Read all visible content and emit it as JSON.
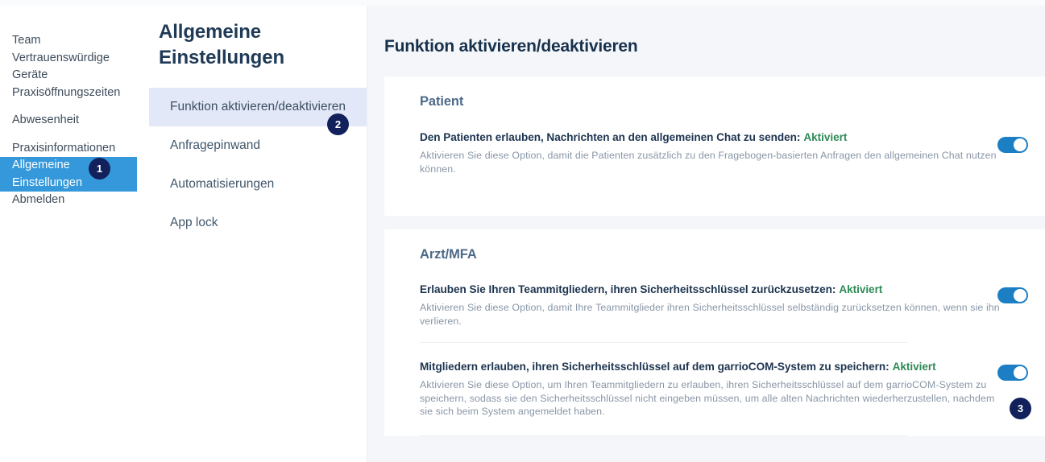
{
  "primary_nav": {
    "items": [
      {
        "label": "Team",
        "active": false,
        "gap": false
      },
      {
        "label": "Vertrauenswürdige\nGeräte",
        "active": false,
        "gap": false
      },
      {
        "label": "Praxisöffnungszeiten",
        "active": false,
        "gap": false
      },
      {
        "label": "Abwesenheit",
        "active": false,
        "gap": true
      },
      {
        "label": "Praxisinformationen",
        "active": false,
        "gap": true
      },
      {
        "label": "Allgemeine\nEinstellungen",
        "active": true,
        "gap": false
      },
      {
        "label": "Abmelden",
        "active": false,
        "gap": false
      }
    ],
    "active_bg_color": "#3498db"
  },
  "secondary_nav": {
    "title": "Allgemeine\nEinstellungen",
    "items": [
      {
        "label": "Funktion aktivieren/deaktivieren",
        "active": true
      },
      {
        "label": "Anfragepinwand",
        "active": false
      },
      {
        "label": "Automatisierungen",
        "active": false
      },
      {
        "label": "App lock",
        "active": false
      }
    ],
    "active_bg_color": "#e3e8f8"
  },
  "main": {
    "page_title": "Funktion aktivieren/deaktivieren",
    "cards": [
      {
        "heading": "Patient",
        "rows": [
          {
            "title": "Den Patienten erlauben, Nachrichten an den allgemeinen Chat zu senden:",
            "status": "Aktiviert",
            "description": "Aktivieren Sie diese Option, damit die Patienten zusätzlich zu den Fragebogen-basierten Anfragen den allgemeinen Chat nutzen können.",
            "toggle_on": true
          }
        ]
      },
      {
        "heading": "Arzt/MFA",
        "rows": [
          {
            "title": "Erlauben Sie Ihren Teammitgliedern, ihren Sicherheitsschlüssel zurückzusetzen:",
            "status": "Aktiviert",
            "description": "Aktivieren Sie diese Option, damit Ihre Teammitglieder ihren Sicherheitsschlüssel selbständig zurücksetzen können, wenn sie ihn verlieren.",
            "toggle_on": true
          },
          {
            "title": "Mitgliedern erlauben, ihren Sicherheitsschlüssel auf dem garrioCOM-System zu speichern:",
            "status": "Aktiviert",
            "description": "Aktivieren Sie diese Option, um Ihren Teammitgliedern zu erlauben, ihren Sicherheitsschlüssel auf dem garrioCOM-System zu speichern, sodass sie den Sicherheitsschlüssel nicht eingeben müssen, um alle alten Nachrichten wiederherzustellen, nachdem sie sich beim System angemeldet haben.",
            "toggle_on": true
          }
        ]
      }
    ],
    "status_color": "#2e8b57",
    "toggle_on_color": "#1c7fc4"
  },
  "annotations": {
    "badge_color": "#12205c",
    "markers": [
      {
        "number": "1"
      },
      {
        "number": "2"
      },
      {
        "number": "3"
      }
    ]
  }
}
